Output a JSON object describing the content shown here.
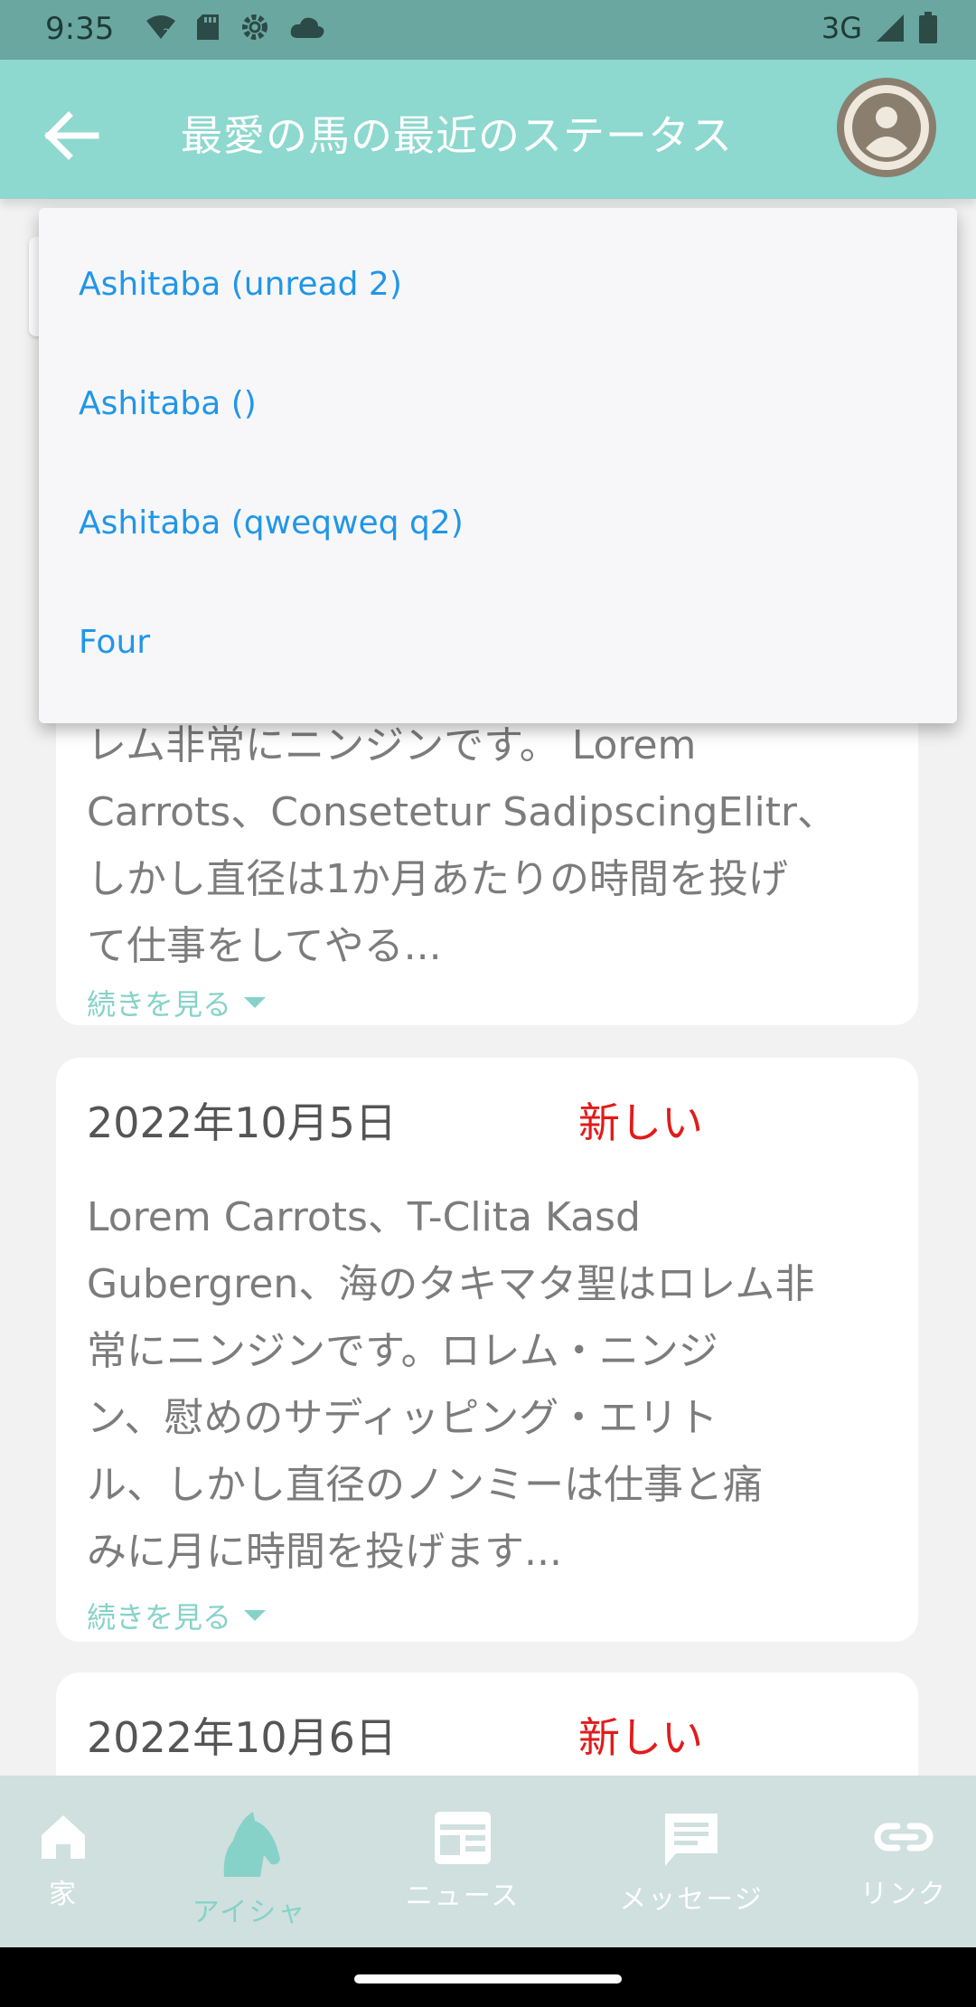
{
  "status_bar": {
    "time": "9:35",
    "network": "3G"
  },
  "app_bar": {
    "title": "最愛の馬の最近のステータス"
  },
  "dropdown": {
    "options": [
      "Ashitaba (unread 2)",
      "Ashitaba ()",
      "Ashitaba (qweqweq q2)",
      "Four"
    ]
  },
  "cards": [
    {
      "body_lines": [
        "レム非常にニンジンです。 Lorem",
        "Carrots、Consetetur SadipscingElitr、",
        "しかし直径は1か月あたりの時間を投げ",
        "て仕事をしてやる..."
      ],
      "more": "続きを見る"
    },
    {
      "date": "2022年10月5日",
      "badge": "新しい",
      "body_lines": [
        "Lorem Carrots、T-Clita Kasd",
        "Gubergren、海のタキマタ聖はロレム非",
        "常にニンジンです。ロレム・ニンジ",
        "ン、慰めのサディッピング・エリト",
        "ル、しかし直径のノンミーは仕事と痛",
        "みに月に時間を投げます..."
      ],
      "more": "続きを見る"
    },
    {
      "date": "2022年10月6日",
      "badge": "新しい"
    }
  ],
  "bottom_nav": {
    "items": [
      {
        "label": "家",
        "icon": "home-icon"
      },
      {
        "label": "アイシャ",
        "icon": "horse-icon"
      },
      {
        "label": "ニュース",
        "icon": "newspaper-icon"
      },
      {
        "label": "メッセージ",
        "icon": "message-icon"
      },
      {
        "label": "リンク",
        "icon": "link-icon"
      }
    ],
    "active_color": "#86d2c8",
    "inactive_color": "#ffffff"
  }
}
